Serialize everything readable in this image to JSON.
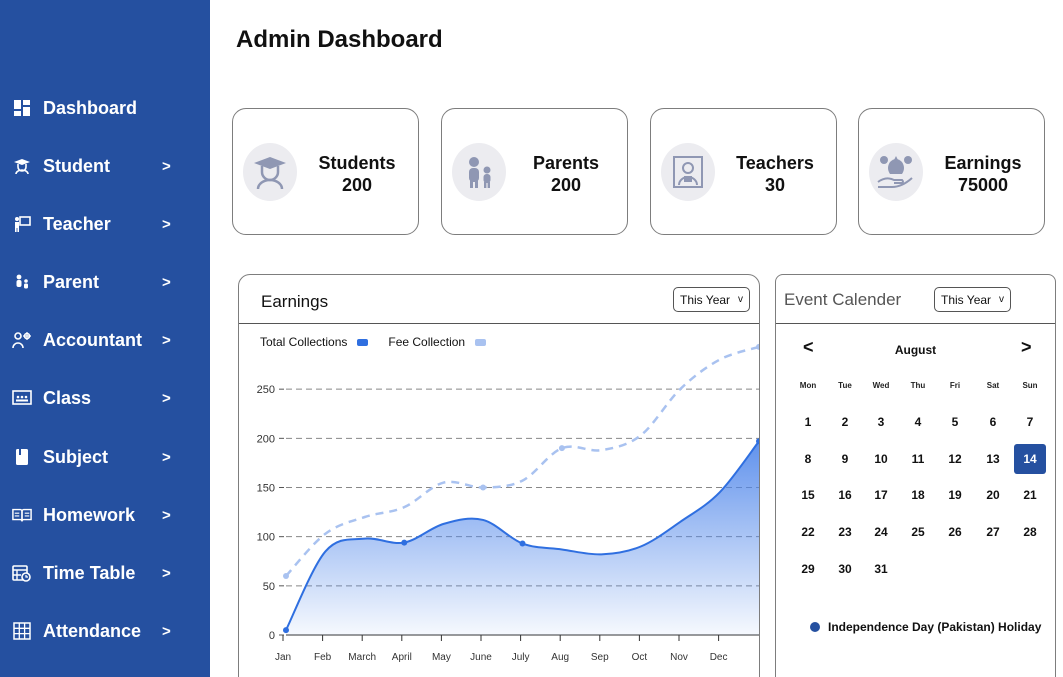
{
  "sidebar": {
    "items": [
      {
        "label": "Dashboard",
        "icon": "dashboard-icon",
        "chevron": ""
      },
      {
        "label": "Student",
        "icon": "student-icon",
        "chevron": ">"
      },
      {
        "label": "Teacher",
        "icon": "teacher-icon",
        "chevron": ">"
      },
      {
        "label": "Parent",
        "icon": "parent-icon",
        "chevron": ">"
      },
      {
        "label": "Accountant",
        "icon": "accountant-icon",
        "chevron": ">"
      },
      {
        "label": "Class",
        "icon": "class-icon",
        "chevron": ">"
      },
      {
        "label": "Subject",
        "icon": "subject-icon",
        "chevron": ">"
      },
      {
        "label": "Homework",
        "icon": "homework-icon",
        "chevron": ">"
      },
      {
        "label": "Time Table",
        "icon": "timetable-icon",
        "chevron": ">"
      },
      {
        "label": "Attendance",
        "icon": "attendance-icon",
        "chevron": ">"
      }
    ]
  },
  "header": {
    "title": "Admin Dashboard"
  },
  "stats": [
    {
      "label": "Students",
      "value": "200",
      "icon": "students-icon"
    },
    {
      "label": "Parents",
      "value": "200",
      "icon": "parents-icon"
    },
    {
      "label": "Teachers",
      "value": "30",
      "icon": "teachers-icon"
    },
    {
      "label": "Earnings",
      "value": "75000",
      "icon": "earnings-icon"
    }
  ],
  "earnings": {
    "title": "Earnings",
    "filter": "This Year",
    "filter_chevron": "v",
    "legend": [
      {
        "label": "Total Collections",
        "color": "#2f6fe0"
      },
      {
        "label": "Fee Collection",
        "color": "#a9c2f0"
      }
    ]
  },
  "chart_data": {
    "type": "area",
    "categories": [
      "Jan",
      "Feb",
      "March",
      "April",
      "May",
      "June",
      "July",
      "Aug",
      "Sep",
      "Oct",
      "Nov",
      "Dec"
    ],
    "series": [
      {
        "name": "Total Collections",
        "style": "area",
        "values": [
          5,
          85,
          98,
          94,
          113,
          117,
          93,
          87,
          82,
          90,
          115,
          145,
          197
        ]
      },
      {
        "name": "Fee Collection",
        "style": "dashed",
        "values": [
          60,
          103,
          120,
          130,
          155,
          150,
          157,
          190,
          188,
          203,
          250,
          280,
          293
        ]
      }
    ],
    "yticks": [
      0,
      50,
      100,
      150,
      200,
      250
    ],
    "ylim": [
      0,
      300
    ],
    "grid": "dashed-horizontal",
    "legend": "top-left",
    "colors": {
      "area_top": "#4f86ea",
      "line": "#2f6fe0",
      "dashed": "#a9c2f0"
    }
  },
  "calendar": {
    "title": "Event Calender",
    "filter": "This Year",
    "filter_chevron": "v",
    "month": "August",
    "prev_glyph": "<",
    "next_glyph": ">",
    "weekdays": [
      "Mon",
      "Tue",
      "Wed",
      "Thu",
      "Fri",
      "Sat",
      "Sun"
    ],
    "days": [
      "1",
      "2",
      "3",
      "4",
      "5",
      "6",
      "7",
      "8",
      "9",
      "10",
      "11",
      "12",
      "13",
      "14",
      "15",
      "16",
      "17",
      "18",
      "19",
      "20",
      "21",
      "22",
      "23",
      "24",
      "25",
      "26",
      "27",
      "28",
      "29",
      "30",
      "31"
    ],
    "selected": "14",
    "event": "Independence Day (Pakistan) Holiday"
  },
  "colors": {
    "brand": "#2550a0",
    "accent": "#2f6fe0"
  }
}
